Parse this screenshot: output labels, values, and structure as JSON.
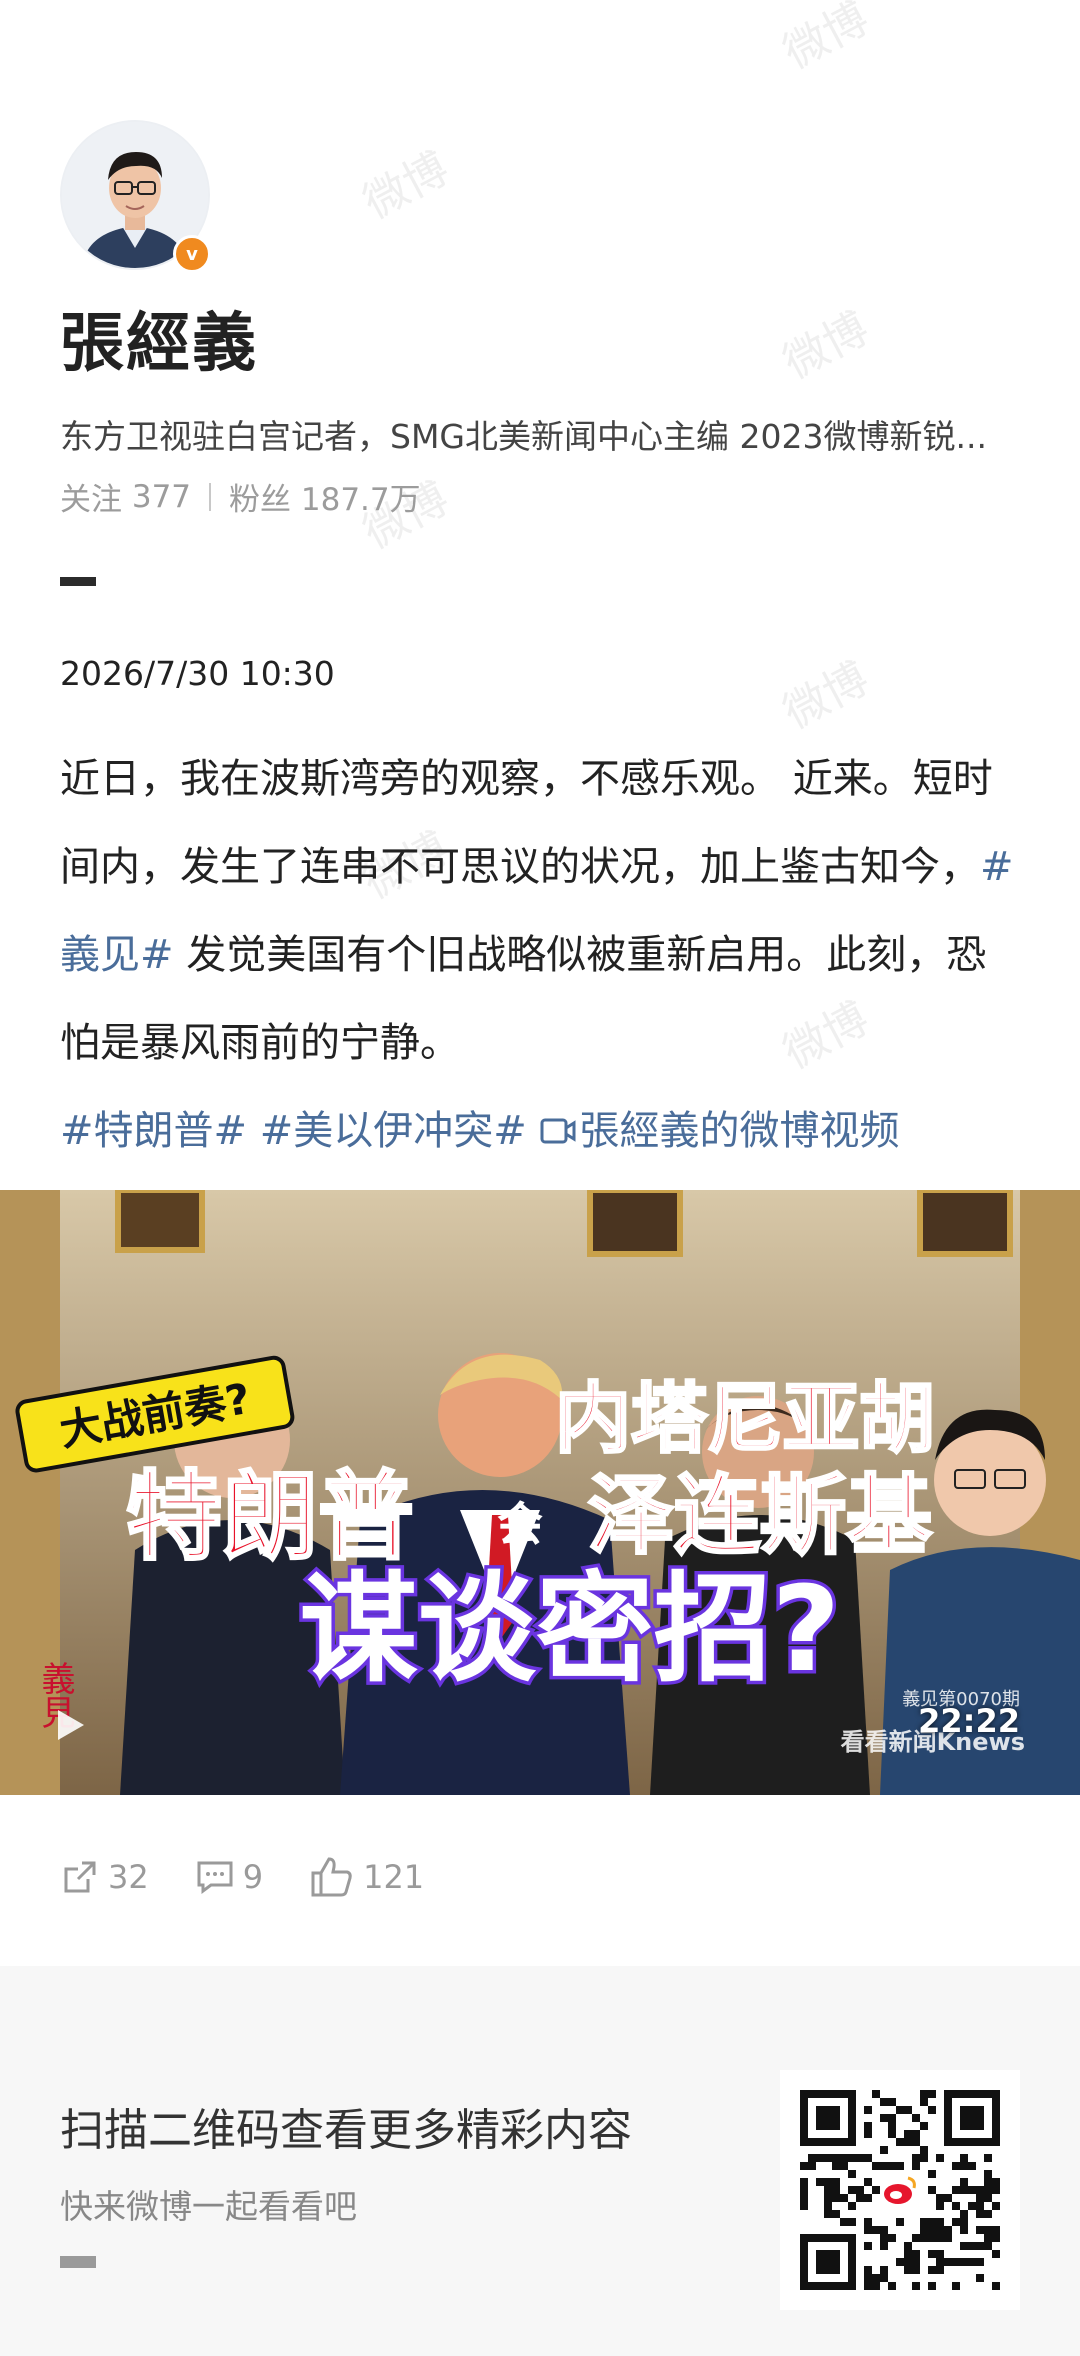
{
  "profile": {
    "name": "張經義",
    "bio": "东方卫视驻白宫记者，SMG北美新闻中心主编 2023微博新锐...",
    "follow_label": "关注",
    "follow_count": "377",
    "fans_label": "粉丝",
    "fans_count": "187.7万",
    "verified_icon": "v-badge-icon"
  },
  "post": {
    "date": "2026/7/30 10:30",
    "text_1": "近日，我在波斯湾旁的观察，不感乐观。 近来。短时间内，发生了连串不可思议的状况，加上鉴古知今，",
    "tag_1": "#義见#",
    "text_2": " 发觉美国有个旧战略似被重新启用。此刻，恐怕是暴风雨前的宁静。",
    "tag_2": "#特朗普#",
    "tag_3": "#美以伊冲突#",
    "video_link": "張經義的微博视频"
  },
  "video": {
    "banner": "大战前奏?",
    "headline_1": "内塔尼亚胡",
    "headline_2a": "特朗普",
    "headline_2b": "会",
    "headline_2c": "泽连斯基",
    "headline_3": "谋谈密招?",
    "seal": "義見",
    "episode": "義见第0070期",
    "brand": "看看新闻Knews",
    "duration": "22:22"
  },
  "actions": {
    "share_count": "32",
    "comment_count": "9",
    "like_count": "121"
  },
  "footer": {
    "title": "扫描二维码查看更多精彩内容",
    "subtitle": "快来微博一起看看吧"
  },
  "watermark": "微博",
  "colors": {
    "tag": "#4a6d9a",
    "verified": "#f08a1f",
    "headline_red": "#e8132a",
    "headline_purple": "#6a34e0"
  }
}
